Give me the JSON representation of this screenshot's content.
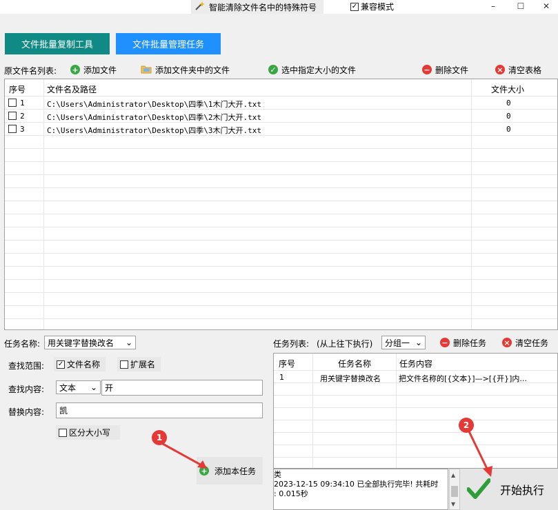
{
  "window": {
    "title": "智能清除文件名中的特殊符号",
    "compat_mode_label": "兼容模式",
    "compat_mode_checked": true,
    "minimize_glyph": "–",
    "maximize_glyph": "☐",
    "close_glyph": "✕"
  },
  "tabs": [
    {
      "label": "文件批量复制工具"
    },
    {
      "label": "文件批量管理任务"
    }
  ],
  "toolbar": {
    "list_label": "原文件名列表:",
    "add_file": "添加文件",
    "add_folder": "添加文件夹中的文件",
    "select_by_size": "选中指定大小的文件",
    "delete_file": "删除文件",
    "clear_table": "清空表格"
  },
  "file_table": {
    "headers": {
      "index": "序号",
      "path": "文件名及路径",
      "size": "文件大小"
    },
    "rows": [
      {
        "index": "1",
        "path": "C:\\Users\\Administrator\\Desktop\\四季\\1木门大开.txt",
        "size": "0",
        "checked": false
      },
      {
        "index": "2",
        "path": "C:\\Users\\Administrator\\Desktop\\四季\\2木门大开.txt",
        "size": "0",
        "checked": false
      },
      {
        "index": "3",
        "path": "C:\\Users\\Administrator\\Desktop\\四季\\3木门大开.txt",
        "size": "0",
        "checked": false
      }
    ]
  },
  "task_config": {
    "task_name_label": "任务名称:",
    "task_name_value": "用关键字替换改名",
    "scope_label": "查找范围:",
    "scope_filename": "文件名称",
    "scope_filename_checked": true,
    "scope_ext": "扩展名",
    "scope_ext_checked": false,
    "find_label": "查找内容:",
    "find_mode": "文本",
    "find_value": "开",
    "replace_label": "替换内容:",
    "replace_value": "凯",
    "case_sensitive": "区分大小写",
    "case_sensitive_checked": false,
    "add_task": "添加本任务"
  },
  "task_list": {
    "label": "任务列表:",
    "exec_order": "(从上往下执行)",
    "group_value": "分组一",
    "delete_task": "删除任务",
    "clear_tasks": "清空任务",
    "headers": {
      "index": "序号",
      "name": "任务名称",
      "content": "任务内容"
    },
    "rows": [
      {
        "index": "1",
        "name": "用关键字替换改名",
        "content": "把文件名称的[{文本}]—>[{开}]内..."
      }
    ]
  },
  "log": {
    "line1": "类",
    "line2": "2023-12-15 09:34:10 已全部执行完毕! 共耗时",
    "line3": ": 0.015秒"
  },
  "start_button": "开始执行",
  "annotations": [
    "1",
    "2"
  ],
  "colors": {
    "tab1": "#0f8a84",
    "tab2": "#1e90ff",
    "annotation": "#e53935",
    "add_green": "#3aa745",
    "delete_red": "#e53935"
  }
}
